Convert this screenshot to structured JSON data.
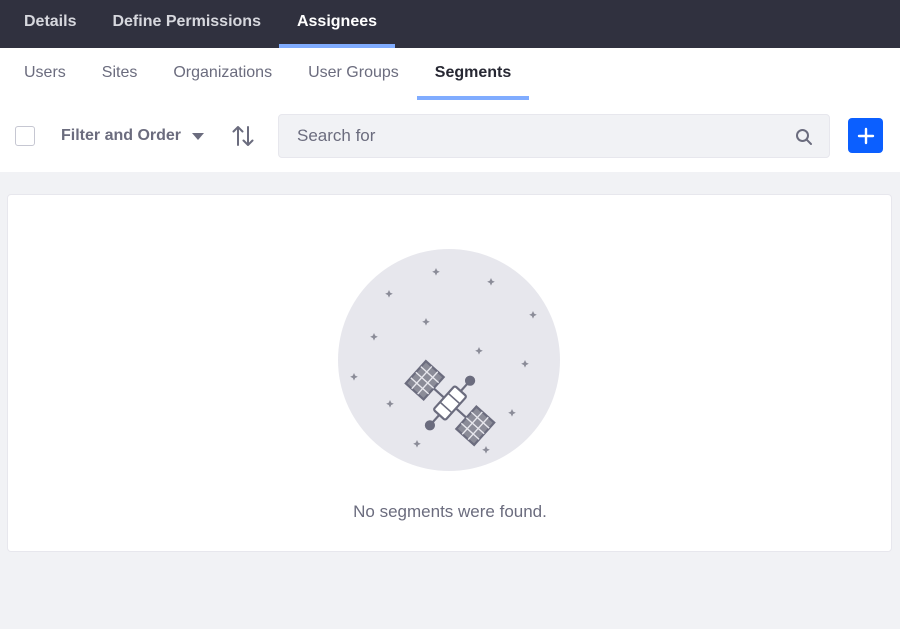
{
  "top_tabs": [
    {
      "label": "Details"
    },
    {
      "label": "Define Permissions"
    },
    {
      "label": "Assignees",
      "active": true
    }
  ],
  "sub_tabs": [
    {
      "label": "Users"
    },
    {
      "label": "Sites"
    },
    {
      "label": "Organizations"
    },
    {
      "label": "User Groups"
    },
    {
      "label": "Segments",
      "active": true
    }
  ],
  "toolbar": {
    "filter_label": "Filter and Order",
    "search_placeholder": "Search for",
    "sort_icon": "sort-arrows-icon",
    "search_icon": "search-icon",
    "add_icon": "plus-icon"
  },
  "empty_state": {
    "message": "No segments were found.",
    "illustration": "satellite-illustration"
  },
  "colors": {
    "topbar": "#30313f",
    "active_underline": "#80acff",
    "primary": "#0b5fff"
  }
}
